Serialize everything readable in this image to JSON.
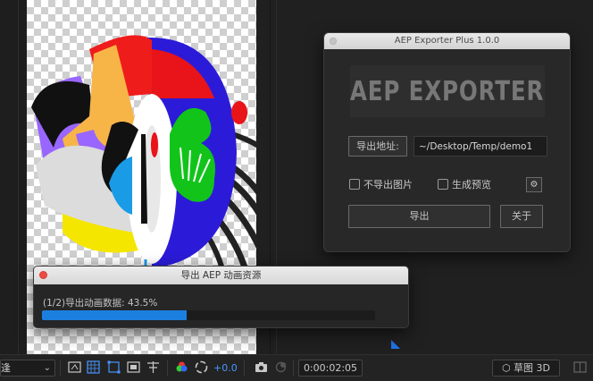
{
  "exporter": {
    "title": "AEP Exporter Plus 1.0.0",
    "logo": "AEP EXPORTER",
    "export_path_button": "导出地址:",
    "export_path_value": "~/Desktop/Temp/demo1",
    "no_images_label": "不导出图片",
    "no_images_checked": false,
    "preview_label": "生成预览",
    "preview_checked": false,
    "settings_icon": "gear-icon",
    "export_button": "导出",
    "about_button": "关于"
  },
  "progress": {
    "title": "导出 AEP 动画资源",
    "status": "(1/2)导出动画数据: 43.5%",
    "percent": 43.5,
    "fill_color": "#1b7fe0"
  },
  "toolbar": {
    "zoom_value": "逢",
    "exposure_value": "+0.0",
    "timecode": "0:00:02:05",
    "renderer_label": "草图 3D",
    "icons": [
      "region-of-interest-icon",
      "transparency-grid-icon",
      "mask-path-icon",
      "guides-icon",
      "rulers-icon",
      "color-channel-icon",
      "reset-exposure-icon",
      "snapshot-icon",
      "show-snapshot-icon",
      "3d-box-icon"
    ]
  },
  "colors": {
    "accent": "#1b7fe0",
    "close_red": "#ee4c43"
  }
}
